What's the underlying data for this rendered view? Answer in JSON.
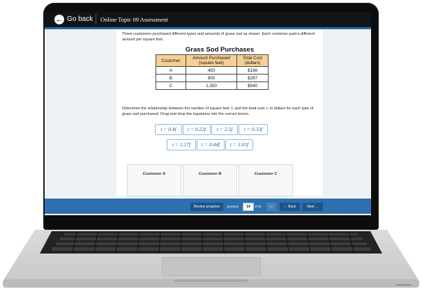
{
  "header": {
    "back_label": "Go back",
    "title": "Online Topic 09 Assessment"
  },
  "question": {
    "prompt": "Three customers purchased different types and amounts of grass sod as shown. Each customer paid a different amount per square foot.",
    "table_title": "Grass Sod Purchases",
    "columns": [
      "Customer",
      "Amount Purchased (square feet)",
      "Total Cost (dollars)"
    ],
    "rows": [
      {
        "customer": "A",
        "amount": "450",
        "cost": "$198"
      },
      {
        "customer": "B",
        "amount": "900",
        "cost": "$297"
      },
      {
        "customer": "C",
        "amount": "1,350",
        "cost": "$540"
      }
    ],
    "instructions": "Determine the relationship between the number of square feet, f, and the total cost, t, in dollars for each type of grass sod purchased. Drag and drop the equations into the correct boxes.",
    "equations": [
      "t = 0.4f",
      "t = 0.22f",
      "t = 2.5f",
      "t = 0.33f",
      "t = 2.27f",
      "t = 0.44f",
      "t = 3.03f"
    ],
    "drop_targets": [
      "Customer A",
      "Customer B",
      "Customer C"
    ]
  },
  "footer": {
    "review_label": "Review progress",
    "question_label": "Question",
    "question_number": "14",
    "of_total": "of 33",
    "go_label": "Go",
    "back_label": "← Back",
    "next_label": "Next →"
  },
  "colors": {
    "header_bg": "#111418",
    "accent": "#1f6fa8",
    "footer_bg": "#2e6fae",
    "table_header": "#f6cf97",
    "tile_text": "#2a5f8f"
  }
}
